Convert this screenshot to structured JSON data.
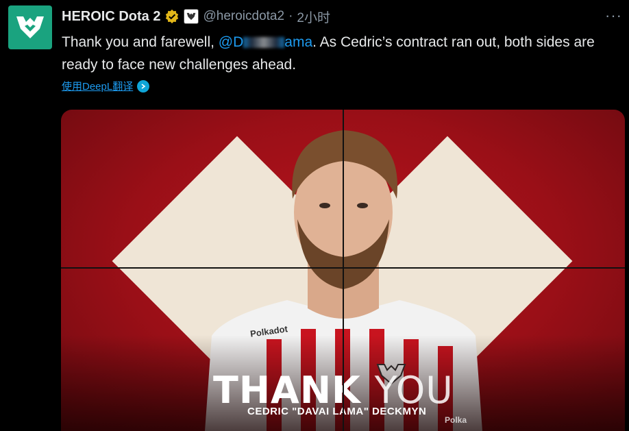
{
  "tweet": {
    "account_name": "HEROIC Dota 2",
    "handle": "@heroicdota2",
    "separator": "·",
    "time": "2小时",
    "more_label": "···",
    "text_before": "Thank you and farewell, ",
    "mention_start": "@D",
    "mention_end": "ama",
    "text_after": ".  As Cedric’s contract ran out, both sides are ready to face new challenges ahead.",
    "translate_label": "使用DeepL翻译"
  },
  "media": {
    "headline_main": "THANK",
    "headline_end": "YOU",
    "player_name": "CEDRIC \"DAVAI LAMA\" DECKMYN",
    "sponsor": "Polkadot",
    "sponsor_bottom": "Polka"
  },
  "colors": {
    "brand_green": "#1aa37f",
    "link_blue": "#1d9bf0",
    "background": "#000000",
    "banner_red": "#b8141d",
    "diamond_cream": "#efe5d6"
  },
  "icons": [
    "heroic-logo-icon",
    "verified-badge-icon",
    "affiliate-badge-icon",
    "deepl-icon",
    "more-icon"
  ]
}
